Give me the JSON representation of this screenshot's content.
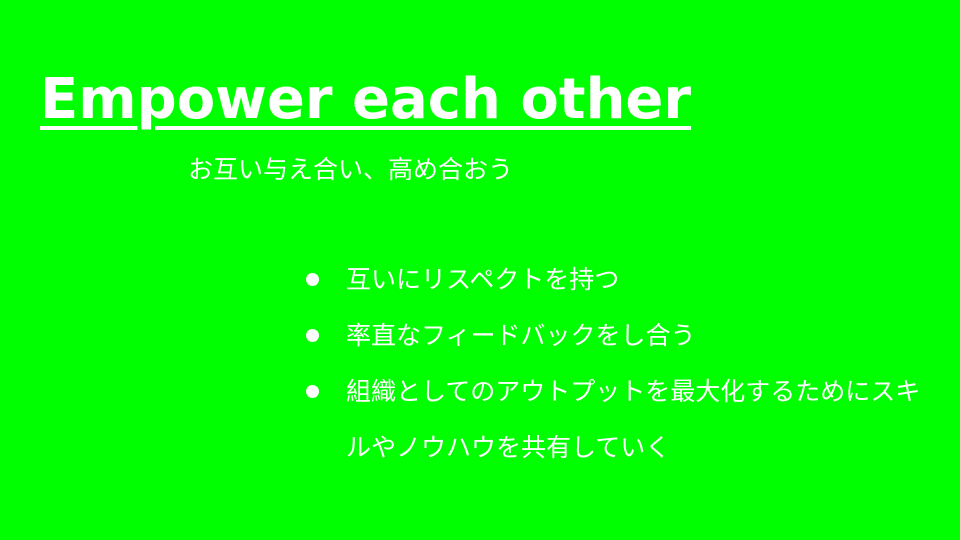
{
  "slide": {
    "title": "Empower each other",
    "subtitle": "お互い与え合い、高め合おう",
    "bullets": [
      "互いにリスペクトを持つ",
      "率直なフィードバックをし合う",
      "組織としてのアウトプットを最大化するためにスキルやノウハウを共有していく"
    ]
  },
  "colors": {
    "background": "#00ff00",
    "text": "#ffffff"
  }
}
